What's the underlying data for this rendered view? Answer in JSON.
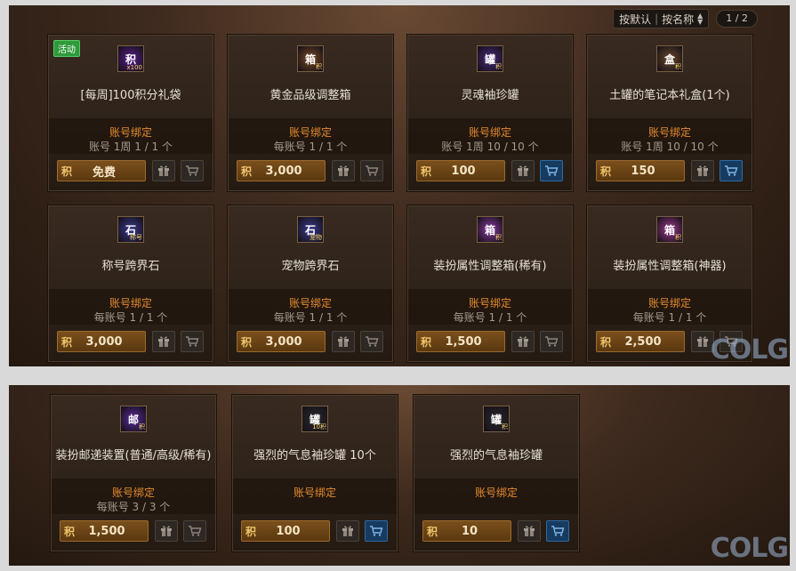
{
  "toolbar": {
    "sort_default": "按默认",
    "sort_separator": "|",
    "sort_name": "按名称",
    "page": "1 / 2"
  },
  "items_row1": [
    {
      "name": "[每周]100积分礼袋",
      "bind": "账号绑定",
      "limit": "账号 1周 1 / 1 个",
      "price_icon": "积",
      "price": "免费",
      "icon_text": "积",
      "icon_sub": "x100",
      "badge": "活动",
      "cart_active": false,
      "icon_bg": "#5b1f8c"
    },
    {
      "name": "黄金品级调整箱",
      "bind": "账号绑定",
      "limit": "每账号 1 / 1 个",
      "price_icon": "积",
      "price": "3,000",
      "icon_text": "箱",
      "icon_sub": "积",
      "cart_active": false,
      "icon_bg": "#7a4b22"
    },
    {
      "name": "灵魂袖珍罐",
      "bind": "账号绑定",
      "limit": "账号 1周 10 / 10 个",
      "price_icon": "积",
      "price": "100",
      "icon_text": "罐",
      "icon_sub": "积",
      "cart_active": true,
      "icon_bg": "#4a2a7a"
    },
    {
      "name": "土罐的笔记本礼盒(1个)",
      "bind": "账号绑定",
      "limit": "账号 1周 10 / 10 个",
      "price_icon": "积",
      "price": "150",
      "icon_text": "盒",
      "icon_sub": "积",
      "cart_active": true,
      "icon_bg": "#6b4a2a"
    }
  ],
  "items_row2": [
    {
      "name": "称号跨界石",
      "bind": "账号绑定",
      "limit": "每账号 1 / 1 个",
      "price_icon": "积",
      "price": "3,000",
      "icon_text": "石",
      "icon_sub": "称号",
      "cart_active": false,
      "icon_bg": "#3a3a8c"
    },
    {
      "name": "宠物跨界石",
      "bind": "账号绑定",
      "limit": "每账号 1 / 1 个",
      "price_icon": "积",
      "price": "3,000",
      "icon_text": "石",
      "icon_sub": "宠物",
      "cart_active": false,
      "icon_bg": "#3a3a8c"
    },
    {
      "name": "装扮属性调整箱(稀有)",
      "bind": "账号绑定",
      "limit": "每账号 1 / 1 个",
      "price_icon": "积",
      "price": "1,500",
      "icon_text": "箱",
      "icon_sub": "积",
      "cart_active": false,
      "icon_bg": "#8c3aa0"
    },
    {
      "name": "装扮属性调整箱(神器)",
      "bind": "账号绑定",
      "limit": "每账号 1 / 1 个",
      "price_icon": "积",
      "price": "2,500",
      "icon_text": "箱",
      "icon_sub": "积",
      "cart_active": false,
      "icon_bg": "#a03a8c"
    }
  ],
  "items_row3": [
    {
      "name": "装扮邮递装置(普通/高级/稀有)",
      "bind": "账号绑定",
      "limit": "每账号 3 / 3 个",
      "price_icon": "积",
      "price": "1,500",
      "icon_text": "邮",
      "icon_sub": "积",
      "cart_active": false,
      "icon_bg": "#5a2a9a"
    },
    {
      "name": "强烈的气息袖珍罐 10个",
      "bind": "账号绑定",
      "limit": "",
      "price_icon": "积",
      "price": "100",
      "icon_text": "罐",
      "icon_sub": "10积",
      "cart_active": true,
      "icon_bg": "#2a2a2a"
    },
    {
      "name": "强烈的气息袖珍罐",
      "bind": "账号绑定",
      "limit": "",
      "price_icon": "积",
      "price": "10",
      "icon_text": "罐",
      "icon_sub": "积",
      "cart_active": true,
      "icon_bg": "#2a2a2a"
    }
  ],
  "watermark": "COLG"
}
